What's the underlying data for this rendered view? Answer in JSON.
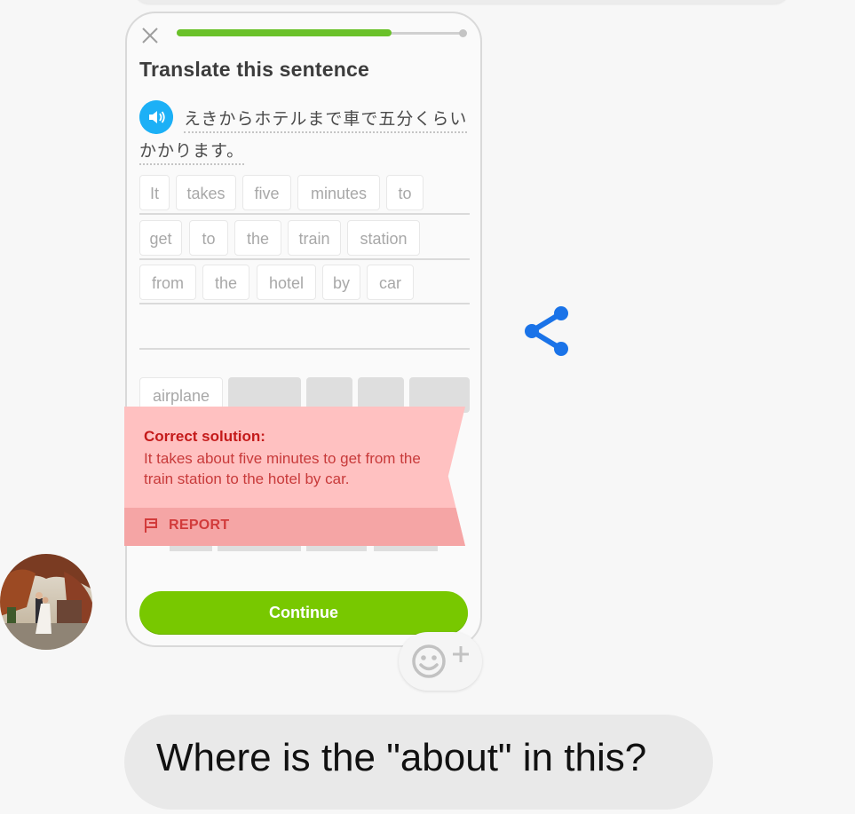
{
  "exercise": {
    "title": "Translate this sentence",
    "japanese_line1": "えきからホテルまで車で五分くらい",
    "japanese_line2": "かかります。",
    "progress": 0.75,
    "answer_words": [
      "It",
      "takes",
      "five",
      "minutes",
      "to",
      "get",
      "to",
      "the",
      "train",
      "station",
      "from",
      "the",
      "hotel",
      "by",
      "car"
    ],
    "word_bank": [
      "airplane"
    ],
    "correction": {
      "heading": "Correct solution:",
      "text": "It takes about five minutes to get from the train station to the hotel by car.",
      "report_label": "REPORT"
    },
    "continue_label": "Continue"
  },
  "chat": {
    "message": "Where is the \"about\" in this?",
    "reaction_icon": "add-emoji-reaction-icon",
    "share_icon": "share-icon"
  },
  "colors": {
    "accent_green": "#78c800",
    "progress_green": "#6ac12a",
    "speaker_blue": "#1cb0f6",
    "share_blue": "#1a73e8",
    "error_red": "#c41a1a",
    "banner_pink": "#ffc1c1"
  }
}
